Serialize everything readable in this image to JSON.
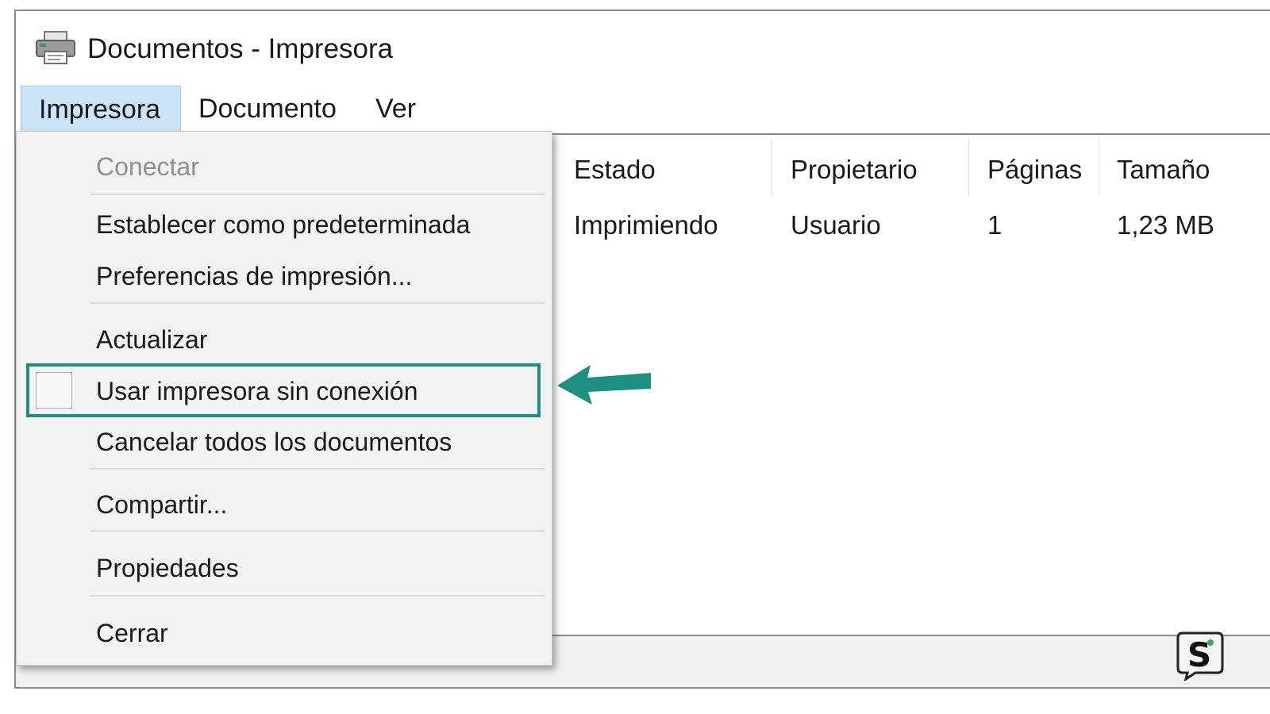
{
  "window": {
    "title": "Documentos - Impresora",
    "icon": "printer-icon"
  },
  "menubar": {
    "items": [
      {
        "label": "Impresora",
        "active": true
      },
      {
        "label": "Documento",
        "active": false
      },
      {
        "label": "Ver",
        "active": false
      }
    ]
  },
  "table": {
    "columns": [
      "Estado",
      "Propietario",
      "Páginas",
      "Tamaño"
    ],
    "rows": [
      [
        "Imprimiendo",
        "Usuario",
        "1",
        "1,23 MB"
      ]
    ]
  },
  "menu": {
    "items": {
      "connect": "Conectar",
      "set_default": "Establecer como predeterminada",
      "print_prefs": "Preferencias de impresión...",
      "refresh": "Actualizar",
      "use_offline": "Usar impresora sin conexión",
      "cancel_all": "Cancelar todos los documentos",
      "share": "Compartir...",
      "properties": "Propiedades",
      "close": "Cerrar"
    },
    "use_offline_checked": false
  },
  "colors": {
    "highlight": "#1a8f82",
    "menubar_active": "#cce4f7",
    "menu_bg": "#f2f2f2"
  },
  "icons": {
    "arrow": "arrow-left-icon",
    "logo": "s-logo-icon"
  }
}
